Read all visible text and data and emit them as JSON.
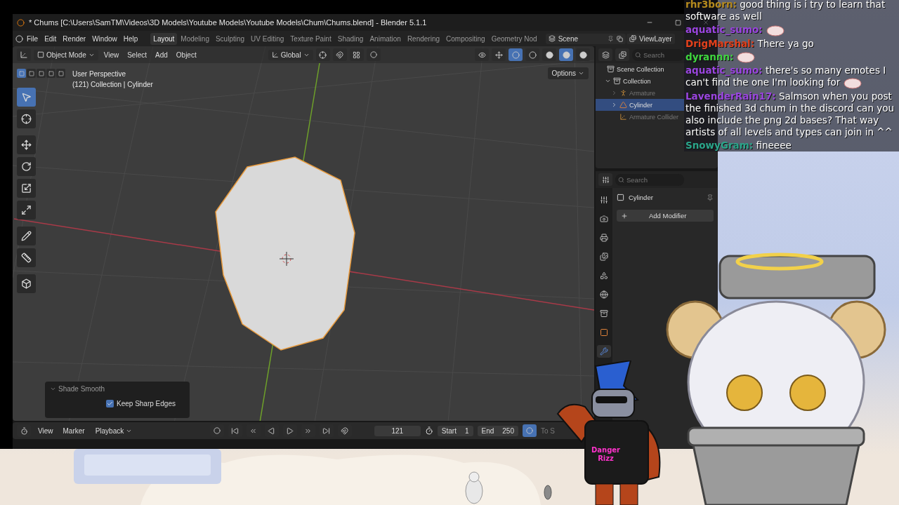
{
  "window": {
    "title": "* Chums [C:\\Users\\SamTM\\Videos\\3D Models\\Youtube Models\\Youtube Models\\Chum\\Chums.blend] - Blender 5.1.1"
  },
  "menu": [
    "File",
    "Edit",
    "Render",
    "Window",
    "Help"
  ],
  "workspaces": [
    {
      "label": "Layout",
      "selected": true
    },
    {
      "label": "Modeling",
      "selected": false
    },
    {
      "label": "Sculpting",
      "selected": false
    },
    {
      "label": "UV Editing",
      "selected": false
    },
    {
      "label": "Texture Paint",
      "selected": false
    },
    {
      "label": "Shading",
      "selected": false
    },
    {
      "label": "Animation",
      "selected": false
    },
    {
      "label": "Rendering",
      "selected": false
    },
    {
      "label": "Compositing",
      "selected": false
    },
    {
      "label": "Geometry Nod",
      "selected": false
    }
  ],
  "scene": {
    "name": "Scene"
  },
  "view_layer": {
    "name": "ViewLayer"
  },
  "viewport": {
    "mode": "Object Mode",
    "menus": [
      "View",
      "Select",
      "Add",
      "Object"
    ],
    "orientation": "Global",
    "options": "Options",
    "info": [
      "User Perspective",
      "(121) Collection | Cylinder"
    ],
    "select_modes": [
      {
        "selected": true
      },
      {
        "selected": false
      },
      {
        "selected": false
      },
      {
        "selected": false
      },
      {
        "selected": false
      }
    ],
    "shading": [
      {
        "selected": false
      },
      {
        "selected": false
      },
      {
        "selected": true
      },
      {
        "selected": false
      }
    ],
    "tools": [
      {
        "kind": "select",
        "selected": true
      },
      {
        "kind": "cursor",
        "selected": false
      },
      {
        "kind": "move",
        "selected": false
      },
      {
        "kind": "rotate",
        "selected": false
      },
      {
        "kind": "scale",
        "selected": false
      },
      {
        "kind": "transform",
        "selected": false
      },
      {
        "kind": "annotate",
        "selected": false
      },
      {
        "kind": "measure",
        "selected": false
      },
      {
        "kind": "add_cube",
        "selected": false
      }
    ]
  },
  "last_operator": {
    "title": "Shade Smooth",
    "options": [
      {
        "label": "Keep Sharp Edges",
        "checked": true
      }
    ]
  },
  "outliner": {
    "search": {
      "placeholder": "Search"
    },
    "items": [
      {
        "label": "Scene Collection",
        "kind": "collection",
        "selected": false,
        "hidden": false,
        "children": [
          {
            "label": "Collection",
            "kind": "collection",
            "selected": false,
            "hidden": false,
            "expanded": true,
            "children": [
              {
                "label": "Armature",
                "kind": "armature",
                "selected": false,
                "hidden": true,
                "expanded": false
              },
              {
                "label": "Cylinder",
                "kind": "mesh",
                "selected": true,
                "hidden": false,
                "expanded": false
              },
              {
                "label": "Armature Collider",
                "kind": "empty",
                "selected": false,
                "hidden": true
              }
            ]
          }
        ]
      }
    ]
  },
  "properties": {
    "search": {
      "placeholder": "Search"
    },
    "object": "Cylinder",
    "add_button": "Add Modifier",
    "tabs": [
      {
        "kind": "tool",
        "selected": false
      },
      {
        "kind": "render",
        "selected": false
      },
      {
        "kind": "output",
        "selected": false
      },
      {
        "kind": "view_layer",
        "selected": false
      },
      {
        "kind": "scene",
        "selected": false
      },
      {
        "kind": "world",
        "selected": false
      },
      {
        "kind": "collection",
        "selected": false
      },
      {
        "kind": "object",
        "selected": false
      },
      {
        "kind": "modifiers",
        "selected": true
      }
    ]
  },
  "timeline": {
    "menus": [
      "View",
      "Marker"
    ],
    "playback": "Playback",
    "frame": "121",
    "start_label": "Start",
    "start": "1",
    "end_label": "End",
    "end": "250",
    "cut_label": "To S"
  },
  "chat": {
    "messages": [
      {
        "user": "rhr3born:",
        "color": "#b58a1e",
        "text": "good thing is i try to learn that software as well",
        "emote": false
      },
      {
        "user": "aquatic_sumo:",
        "color": "#9a45e0",
        "emote": true
      },
      {
        "user": "DrigMarshal:",
        "color": "#e2401c",
        "text": "There ya go",
        "emote": false
      },
      {
        "user": "dyrannn:",
        "color": "#3fd43f",
        "emote": true
      },
      {
        "user": "aquatic_sumo:",
        "color": "#9a45e0",
        "text": "there's so many emotes I can't find the one I'm looking for",
        "emote": true
      },
      {
        "user": "LavenderRain17:",
        "color": "#9a45e0",
        "text": "Salmson when you post the finished 3d chum in the discord can you also include the png 2d bases? That way artists of all levels and types can join in ^^",
        "emote": false
      },
      {
        "user": "SnowyGram:",
        "color": "#2aa58a",
        "text": "fineeee",
        "emote": false
      }
    ]
  },
  "overlay": {
    "mascot_text": [
      "Danger",
      "Rizz"
    ]
  }
}
